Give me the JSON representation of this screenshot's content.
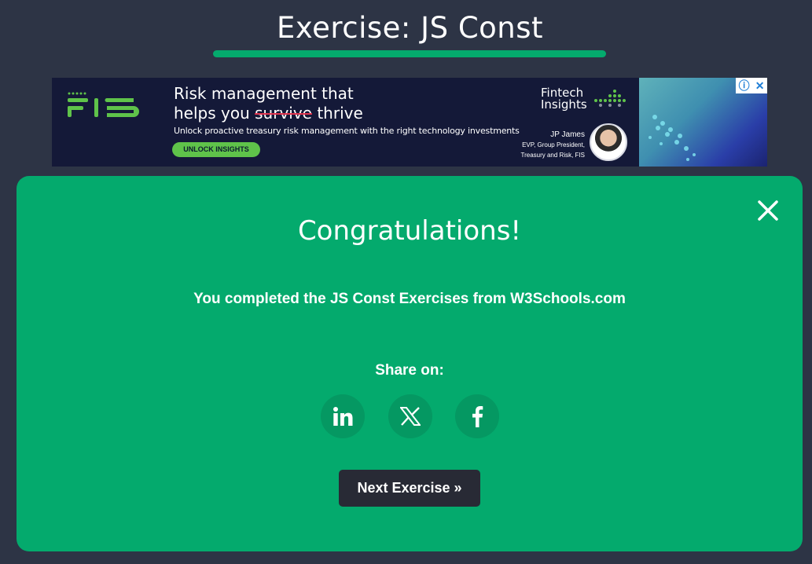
{
  "header": {
    "title": "Exercise: JS Const"
  },
  "ad": {
    "logo_text": "FIS",
    "headline_line1": "Risk management that",
    "headline_prefix": "helps you ",
    "headline_struck": "survive",
    "headline_suffix": " thrive",
    "subtext": "Unlock proactive treasury risk management with the right technology investments",
    "cta_label": "UNLOCK INSIGHTS",
    "brand_line1": "Fintech",
    "brand_line2": "Insights",
    "person_name": "JP James",
    "person_title1": "EVP, Group President,",
    "person_title2": "Treasury and Risk, FIS",
    "brand_color": "#5fc34a"
  },
  "modal": {
    "heading": "Congratulations!",
    "message": "You completed the JS Const Exercises from W3Schools.com",
    "share_label": "Share on:",
    "share_icons": [
      "linkedin-icon",
      "x-icon",
      "facebook-icon"
    ],
    "next_label": "Next Exercise »",
    "accent_color": "#04aa6d",
    "close_icon": "close-icon"
  }
}
